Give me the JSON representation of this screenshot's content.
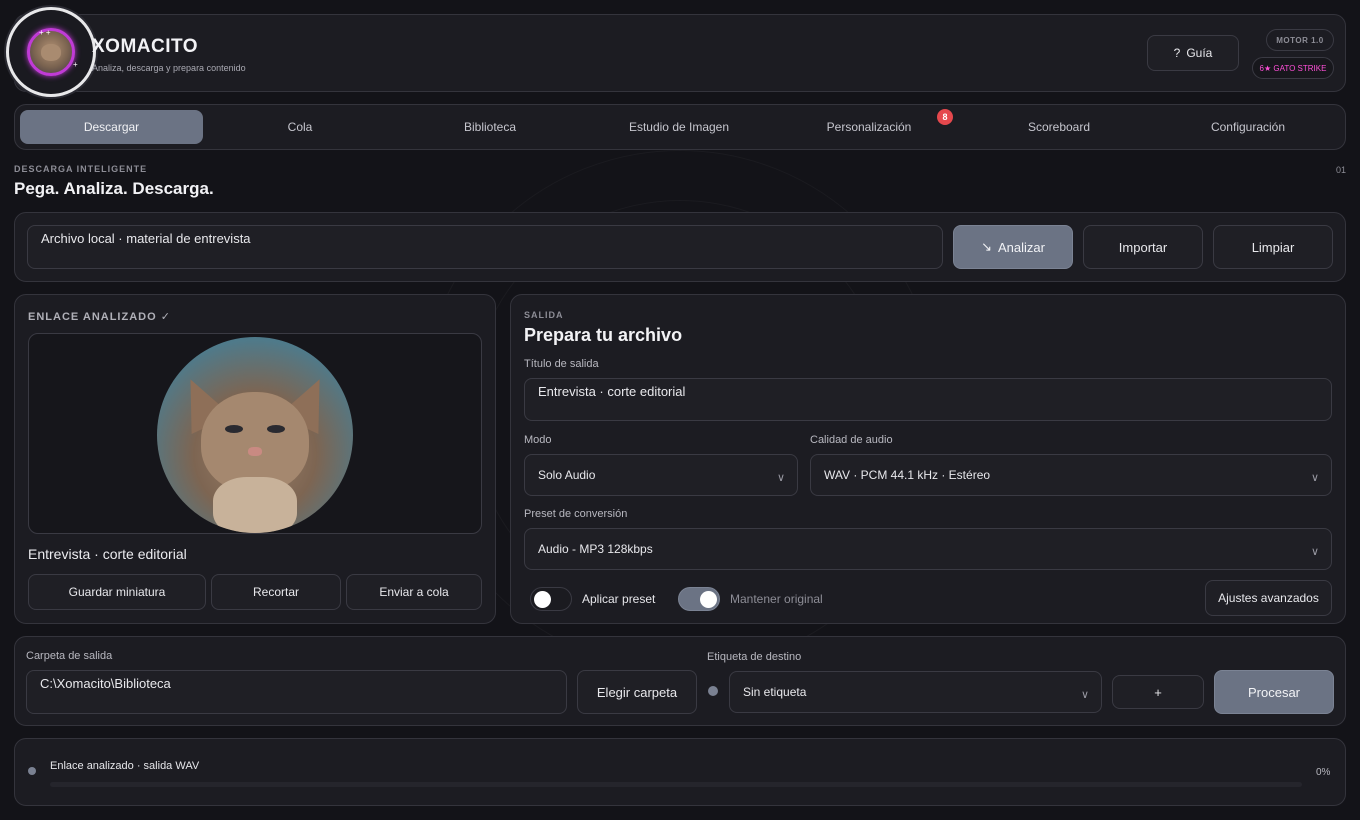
{
  "header": {
    "app_title": "XOMACITO",
    "subtitle": "Analiza, descarga y prepara contenido",
    "guide_label": "Guía",
    "guide_icon": "?",
    "engine_badge": "MOTOR 1.0",
    "strike_badge": "6★ GATO STRIKE"
  },
  "tabs": [
    {
      "label": "Descargar",
      "active": true
    },
    {
      "label": "Cola"
    },
    {
      "label": "Biblioteca"
    },
    {
      "label": "Estudio de Imagen"
    },
    {
      "label": "Personalización",
      "badge": "8"
    },
    {
      "label": "Scoreboard"
    },
    {
      "label": "Configuración"
    }
  ],
  "section": {
    "eyebrow": "DESCARGA INTELIGENTE",
    "title": "Pega. Analiza. Descarga.",
    "step": "01"
  },
  "input_bar": {
    "source_value": "Archivo local · material de entrevista",
    "analyze_label": "Analizar",
    "analyze_icon": "↘",
    "import_label": "Importar",
    "clear_label": "Limpiar"
  },
  "analyzed": {
    "heading": "ENLACE ANALIZADO ✓",
    "media_title": "Entrevista · corte editorial",
    "save_thumb_label": "Guardar miniatura",
    "crop_label": "Recortar",
    "send_queue_label": "Enviar a cola"
  },
  "output": {
    "eyebrow": "SALIDA",
    "title": "Prepara tu archivo",
    "title_field_label": "Título de salida",
    "title_field_value": "Entrevista · corte editorial",
    "mode_label": "Modo",
    "mode_value": "Solo Audio",
    "quality_label": "Calidad de audio",
    "quality_value": "WAV · PCM 44.1 kHz · Estéreo",
    "preset_label": "Preset de conversión",
    "preset_value": "Audio - MP3 128kbps",
    "apply_preset_label": "Aplicar preset",
    "apply_preset_on": false,
    "keep_original_label": "Mantener original",
    "keep_original_on": true,
    "advanced_label": "Ajustes avanzados"
  },
  "destination": {
    "folder_label": "Carpeta de salida",
    "folder_value": "C:\\Xomacito\\Biblioteca",
    "choose_folder_label": "Elegir carpeta",
    "tag_label": "Etiqueta de destino",
    "tag_value": "Sin etiqueta",
    "add_label": "+",
    "process_label": "Procesar"
  },
  "status": {
    "text": "Enlace analizado · salida WAV",
    "percent": "0%",
    "progress": 0
  },
  "colors": {
    "accent": "#6b7384",
    "badge_red": "#e5484d",
    "strike_pink": "#ff4fd8",
    "avatar_ring": "#c03bd6"
  }
}
